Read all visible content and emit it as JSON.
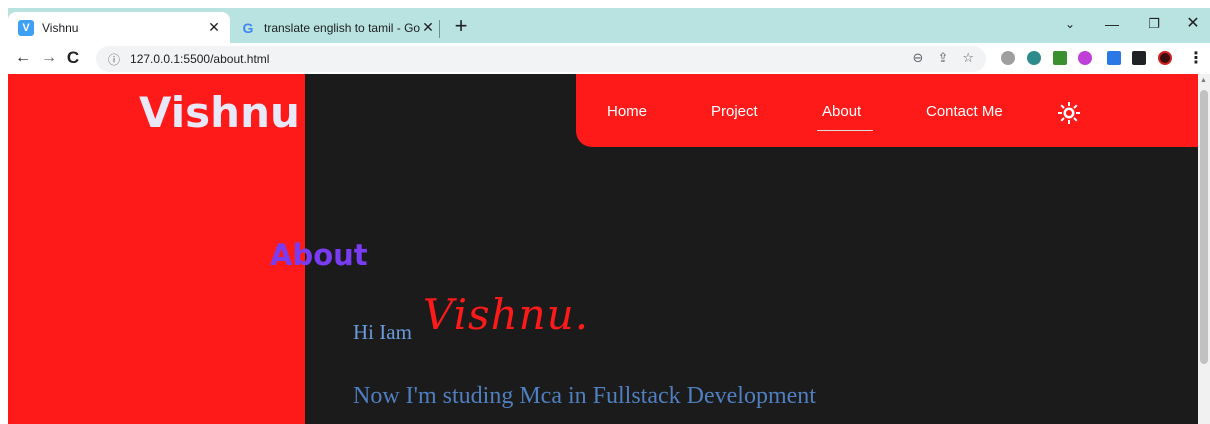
{
  "browser": {
    "tabs": [
      {
        "title": "Vishnu",
        "favicon": "V",
        "active": true
      },
      {
        "title": "translate english to tamil - Googl",
        "favicon": "G",
        "active": false
      }
    ],
    "close_glyph": "✕",
    "new_tab": "+",
    "window_controls": {
      "dropdown": "⌄",
      "minimize": "—",
      "restore": "❐",
      "close": "✕"
    },
    "nav": {
      "back": "←",
      "forward": "→",
      "reload": "C"
    },
    "address": {
      "info_icon": "ⓘ",
      "url": "127.0.0.1:5500/about.html"
    },
    "menu": "⋮",
    "colors": {
      "tabstrip": "#b8e3e0"
    }
  },
  "page": {
    "logo": "Vishnu",
    "nav_links": [
      "Home",
      "Project",
      "About",
      "Contact Me"
    ],
    "active_link": "About",
    "heading": "About",
    "greeting": "Hi Iam",
    "name": "Vishnu.",
    "study": "Now I'm studing Mca in Fullstack Development",
    "colors": {
      "accent_red": "#ff1a1a",
      "background": "#1b1b1b",
      "heading_purple": "#7a3cf2",
      "text_blue": "#6a9bdb"
    },
    "theme_toggle_icon": "sun-icon"
  }
}
